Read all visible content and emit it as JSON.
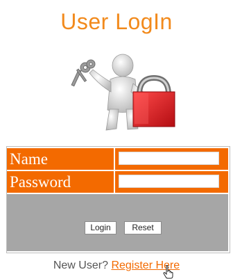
{
  "header": {
    "title": "User LogIn"
  },
  "form": {
    "name_label": "Name",
    "name_value": "",
    "password_label": "Password",
    "password_value": "",
    "login_button": "Login",
    "reset_button": "Reset"
  },
  "footer": {
    "new_user_text": "New User?",
    "register_link": "Register Here"
  },
  "colors": {
    "title": "#f28a1c",
    "label_background": "#f36a00",
    "label_text": "#ffffff",
    "action_background": "#a6a6a6",
    "lock_red": "#e01b22",
    "link": "#f36a00"
  },
  "icons": {
    "hero": "person-holding-keys-with-padlock-icon",
    "cursor": "hand-pointer-cursor-icon"
  }
}
